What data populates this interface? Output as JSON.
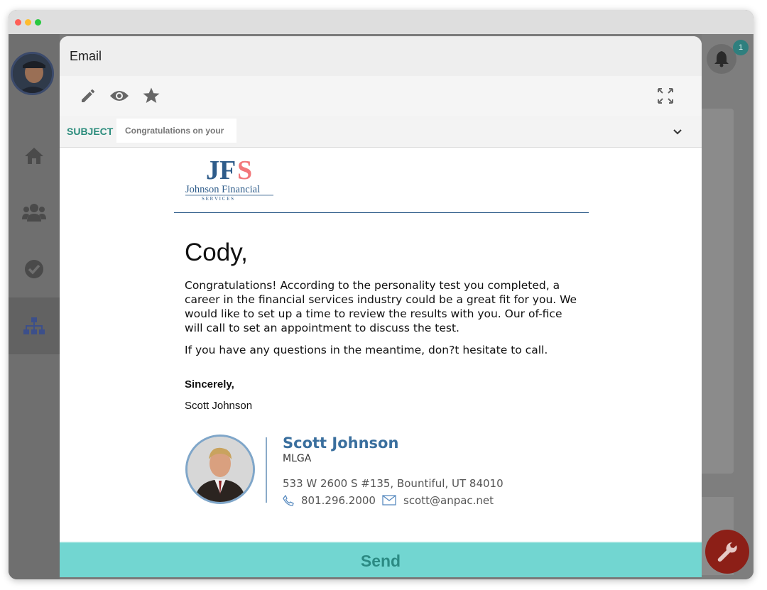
{
  "window": {
    "traffic_colors": [
      "#ff5f57",
      "#febc2e",
      "#28c840"
    ]
  },
  "sidebar": {
    "items": [
      {
        "icon": "home-icon"
      },
      {
        "icon": "users-icon"
      },
      {
        "icon": "check-circle-icon"
      },
      {
        "icon": "org-chart-icon",
        "active": true
      }
    ]
  },
  "notifications": {
    "count": "1"
  },
  "email_modal": {
    "title": "Email",
    "subject_label": "SUBJECT",
    "subject_value": "Congratulations on your",
    "toolbar": [
      "edit-icon",
      "preview-eye-icon",
      "star-icon",
      "fullscreen-icon"
    ],
    "logo": {
      "letters": "JFS",
      "line1": "Johnson Financial",
      "line2": "S E R V I C E S"
    },
    "greeting": "Cody,",
    "paragraph1": "Congratulations! According to the personality test you completed, a career in the financial services industry could be a great fit for you. We would like to set up a time to review the results with you. Our of-fice will call to set an appointment to discuss the test.",
    "paragraph2": "If you have any questions in the meantime, don?t hesitate to call.",
    "closing": "Sincerely,",
    "sender": "Scott Johnson",
    "signature": {
      "name": "Scott Johnson",
      "title": "MLGA",
      "address": "533 W 2600 S #135, Bountiful, UT 84010",
      "phone": "801.296.2000",
      "email": "scott@anpac.net"
    },
    "send_label": "Send",
    "colors": {
      "accent": "#2b8c7c",
      "send_bg": "#72d6d1",
      "signature_blue": "#3a6f9e"
    }
  }
}
